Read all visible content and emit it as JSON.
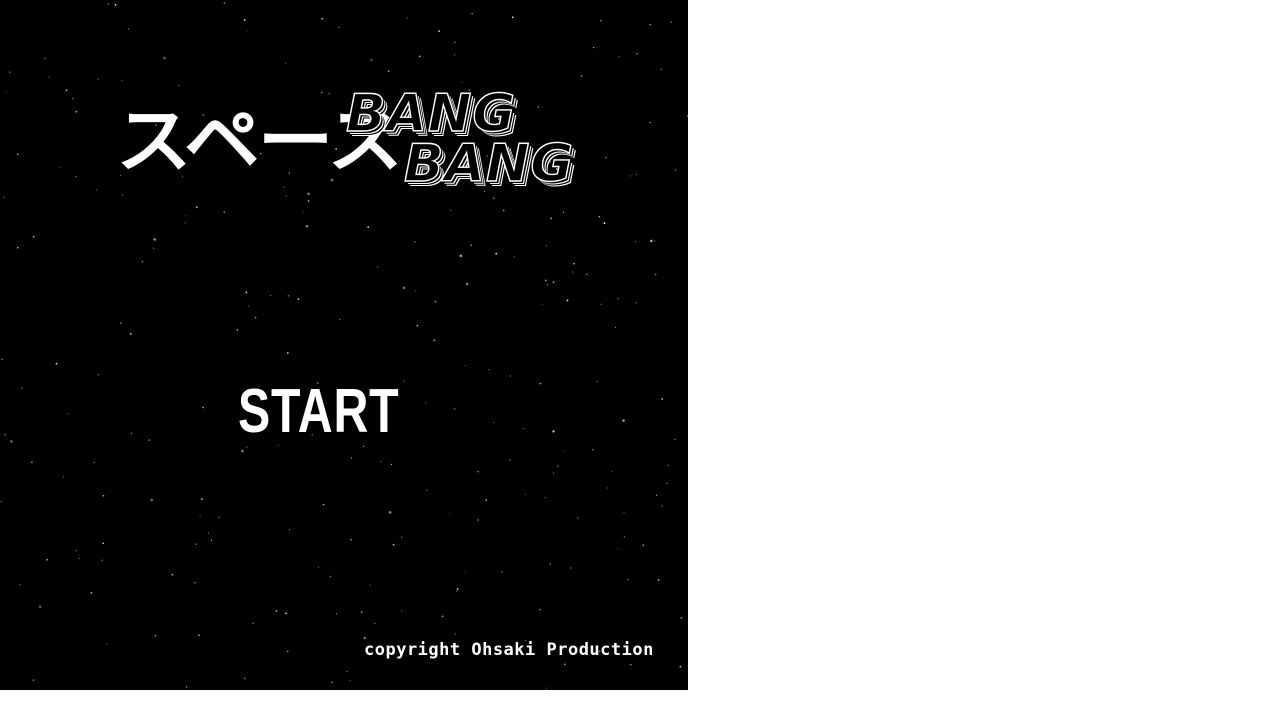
{
  "title": {
    "japanese": "スペース",
    "bang_line_1": "BANG",
    "bang_line_2": "BANG"
  },
  "menu": {
    "start_label": "START"
  },
  "footer": {
    "copyright": "copyright Ohsaki Production"
  },
  "colors": {
    "background": "#000000",
    "text": "#ffffff",
    "page": "#ffffff"
  }
}
